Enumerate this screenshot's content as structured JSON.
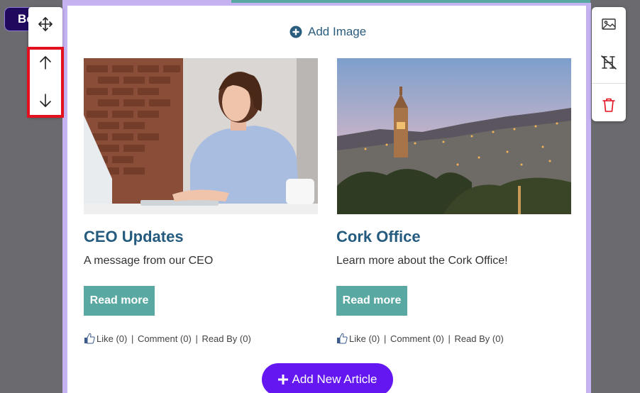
{
  "badge": {
    "label": "Bo"
  },
  "left_toolbar": {
    "icons": [
      "move-arrows-icon",
      "arrow-up-icon",
      "arrow-down-icon"
    ]
  },
  "right_toolbar": {
    "icons": [
      "image-icon",
      "heading-off-icon",
      "trash-icon"
    ],
    "delete_color": "#e3101f"
  },
  "add_image": {
    "label": "Add Image",
    "icon": "plus-circle-icon"
  },
  "articles": [
    {
      "image": "woman-typing-at-laptop",
      "title": "CEO Updates",
      "description": "A message from our CEO",
      "button": "Read more",
      "like": "Like (0)",
      "comment": "Comment (0)",
      "read_by": "Read By (0)"
    },
    {
      "image": "cork-city-skyline-dusk",
      "title": "Cork Office",
      "description": "Learn more about the Cork Office!",
      "button": "Read more",
      "like": "Like (0)",
      "comment": "Comment (0)",
      "read_by": "Read By (0)"
    }
  ],
  "add_article": {
    "label": "Add New Article",
    "icon": "plus-icon"
  },
  "colors": {
    "accent_teal": "#5aa8a2",
    "title_blue": "#255b7e",
    "primary_purple": "#6417f0",
    "highlight_red": "#e3101f",
    "canvas_border": "#c6b3f2"
  }
}
